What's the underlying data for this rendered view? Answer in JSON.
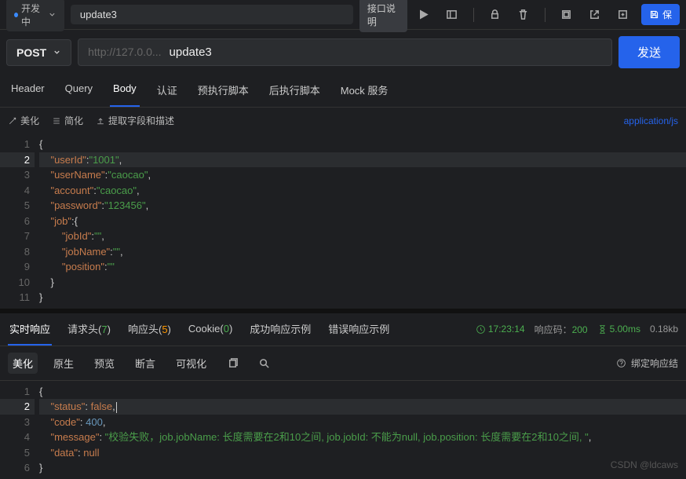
{
  "topbar": {
    "status": "开发中",
    "title": "update3",
    "api_doc": "接口说明",
    "save": "保"
  },
  "request": {
    "method": "POST",
    "url_placeholder": "http://127.0.0...",
    "url_path": "update3",
    "send": "发送"
  },
  "tabs": [
    "Header",
    "Query",
    "Body",
    "认证",
    "预执行脚本",
    "后执行脚本",
    "Mock 服务"
  ],
  "active_tab": 2,
  "toolbar": {
    "beautify": "美化",
    "simplify": "简化",
    "extract": "提取字段和描述",
    "content_type": "application/js"
  },
  "request_body_lines": [
    "1",
    "2",
    "3",
    "4",
    "5",
    "6",
    "7",
    "8",
    "9",
    "10",
    "11"
  ],
  "request_body": {
    "userId": "1001",
    "userName": "caocao",
    "account": "caocao",
    "password": "123456",
    "job": {
      "jobId": "",
      "jobName": "",
      "position": ""
    }
  },
  "response": {
    "tabs": {
      "realtime": "实时响应",
      "req_headers": "请求头",
      "req_headers_count": "7",
      "resp_headers": "响应头",
      "resp_headers_count": "5",
      "cookie": "Cookie",
      "cookie_count": "0",
      "success_example": "成功响应示例",
      "error_example": "错误响应示例"
    },
    "meta": {
      "time": "17:23:14",
      "status_label": "响应码：",
      "status_code": "200",
      "duration": "5.00ms",
      "size": "0.18kb"
    },
    "sub_tabs": [
      "美化",
      "原生",
      "预览",
      "断言",
      "可视化"
    ],
    "bind_result": "绑定响应结",
    "body_lines": [
      "1",
      "2",
      "3",
      "4",
      "5",
      "6"
    ],
    "body": {
      "status": false,
      "code": 400,
      "message": "校验失败，job.jobName: 长度需要在2和10之间, job.jobId: 不能为null, job.position: 长度需要在2和10之间, ",
      "data": null
    }
  },
  "watermark": "CSDN @ldcaws"
}
